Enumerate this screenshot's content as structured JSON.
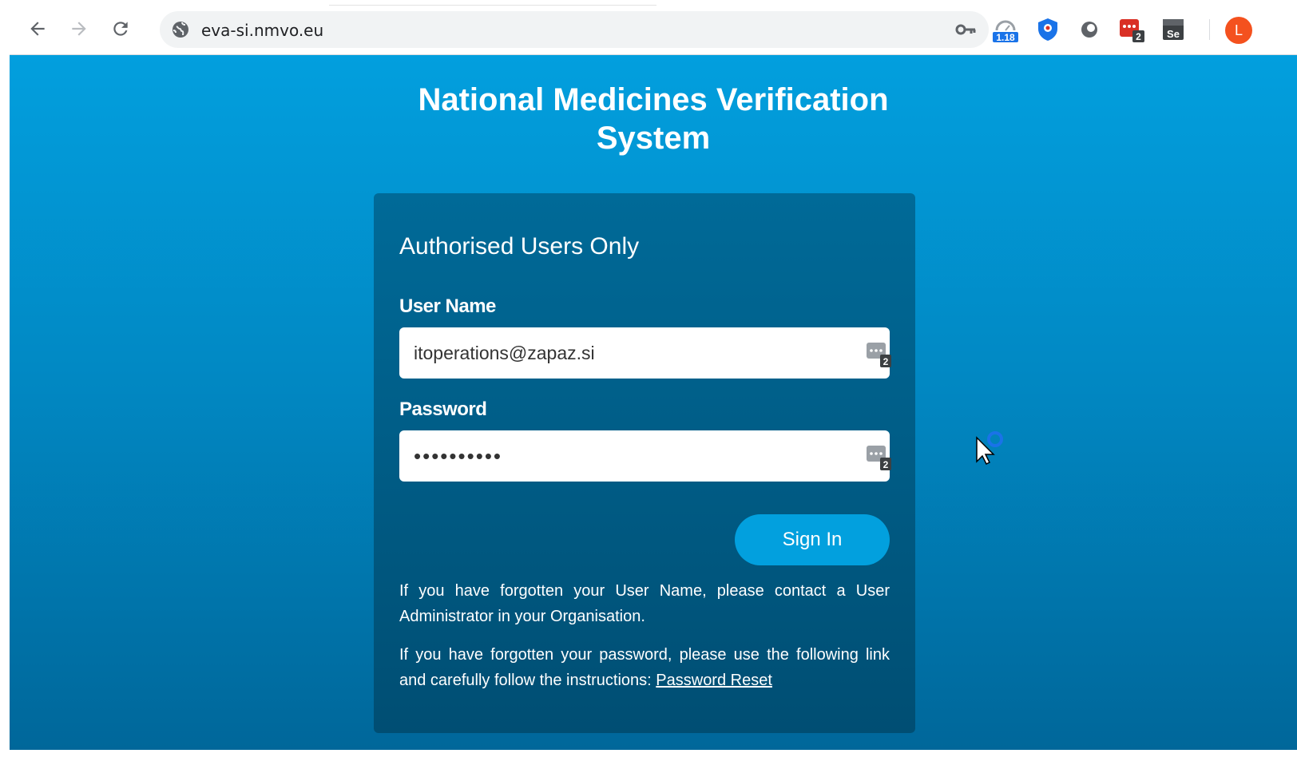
{
  "browser": {
    "url": "eva-si.nmvo.eu",
    "extensions": [
      {
        "icon": "speedometer-extension-icon",
        "badge": "1.18"
      },
      {
        "icon": "shield-extension-icon"
      },
      {
        "icon": "circle-extension-icon"
      },
      {
        "icon": "password-manager-extension-icon",
        "badge": "2"
      },
      {
        "icon": "selenium-extension-icon",
        "text": "Se"
      }
    ],
    "profile_initial": "L",
    "colors": {
      "profile": "#f4511e"
    }
  },
  "page": {
    "title": "National Medicines Verification System",
    "colors": {
      "background_top": "#029fde",
      "background_bottom": "#00679a",
      "card": "#005a85",
      "button": "#02a0de"
    }
  },
  "login": {
    "heading": "Authorised Users Only",
    "username_label": "User Name",
    "username_value": "itoperations@zapaz.si",
    "password_label": "Password",
    "password_value": "••••••••••",
    "field_badge_count": "2",
    "sign_in_label": "Sign In",
    "help_username": "If you have forgotten your User Name, please contact a User Administrator in your Organisation.",
    "help_password_prefix": "If you have forgotten your password, please use the following link and carefully follow the instructions: ",
    "password_reset_link": "Password Reset"
  }
}
